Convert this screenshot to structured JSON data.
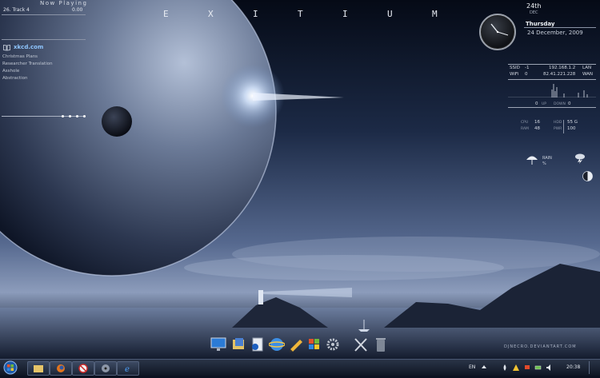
{
  "now_playing": {
    "title": "Now Playing",
    "track": "26. Track 4",
    "time": "0.00"
  },
  "brand": {
    "letters": [
      "E",
      "X",
      "I",
      "T",
      "I",
      "U",
      "M"
    ]
  },
  "rss": {
    "site": "xkcd.com",
    "items": [
      "Christmas Plans",
      "Researcher Translation",
      "Asshole",
      "Abstraction"
    ]
  },
  "date": {
    "day": "24th",
    "month": "DEC",
    "weekday": "Thursday",
    "full": "24 December, 2009"
  },
  "network": {
    "ssid_label": "SSID",
    "ssid_value": "-1",
    "lan_ip": "192.168.1.2",
    "lan_label": "LAN",
    "wifi_label": "WiFi",
    "wifi_value": "0",
    "wan_ip": "82.41.221.228",
    "wan_label": "WAN",
    "up_value": "0",
    "up_label": "UP",
    "down_label": "DOWN",
    "down_value": "0"
  },
  "system": {
    "cpu_label": "CPU",
    "cpu_value": "16",
    "hdd_label": "HDD",
    "hdd_value": "55 G",
    "ram_label": "RAM",
    "ram_value": "48",
    "pwr_label": "PWR",
    "pwr_value": "100"
  },
  "weather": {
    "condition": "RAIN",
    "value": "%"
  },
  "watermark": "DJNECRO.DEVIANTART.COM",
  "dock": {
    "icons": [
      "monitor-icon",
      "folders-icon",
      "documents-icon",
      "internet-globe-icon",
      "pencil-icon",
      "windows-flag-icon",
      "gear-icon",
      "tools-icon",
      "trash-icon"
    ]
  },
  "taskbar": {
    "buttons": [
      "explorer-icon",
      "firefox-icon",
      "stop-icon",
      "media-icon",
      "internet-explorer-icon"
    ],
    "language": "EN",
    "clock": "20:38",
    "accent": "#2a3447"
  },
  "colors": {
    "sky_top": "#0a1222",
    "sky_mid": "#4a5d82",
    "horizon": "#c7d2e6",
    "planet": "#5c6a85"
  }
}
